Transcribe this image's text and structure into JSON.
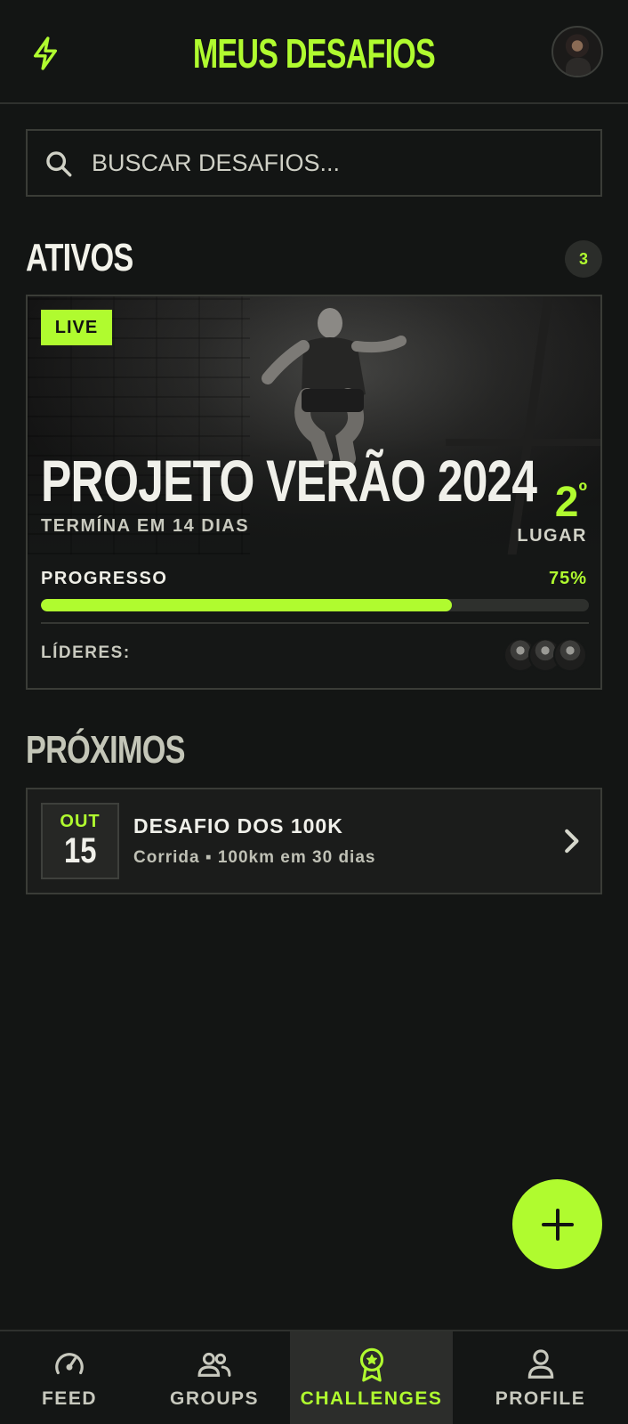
{
  "header": {
    "title": "MEUS DESAFIOS",
    "left_icon": "bolt-icon",
    "avatar": "user-avatar"
  },
  "search": {
    "placeholder": "BUSCAR DESAFIOS...",
    "value": ""
  },
  "active_section": {
    "title": "ATIVOS",
    "count": "3"
  },
  "active_card": {
    "badge": "LIVE",
    "title": "PROJETO VERÃO 2024",
    "subtitle": "TERMÍNA EM 14 DIAS",
    "rank_number": "2",
    "rank_suffix": "º",
    "rank_label": "LUGAR",
    "progress_label": "PROGRESSO",
    "progress_value": "75%",
    "progress": 0.75,
    "leaders_label": "LÍDERES:"
  },
  "upcoming_section": {
    "title": "PRÓXIMOS"
  },
  "upcoming": [
    {
      "month": "OUT",
      "day": "15",
      "title": "DESAFIO DOS 100K",
      "subtitle": "Corrida ▪ 100km em 30 dias"
    }
  ],
  "bottom_nav": {
    "items": [
      {
        "label": "FEED",
        "icon": "speedometer-icon",
        "active": false
      },
      {
        "label": "GROUPS",
        "icon": "group-icon",
        "active": false
      },
      {
        "label": "CHALLENGES",
        "icon": "award-icon",
        "active": true
      },
      {
        "label": "PROFILE",
        "icon": "person-icon",
        "active": false
      }
    ]
  },
  "colors": {
    "accent": "#b0fb2f",
    "background": "#131514",
    "card": "#1b1c1b"
  }
}
